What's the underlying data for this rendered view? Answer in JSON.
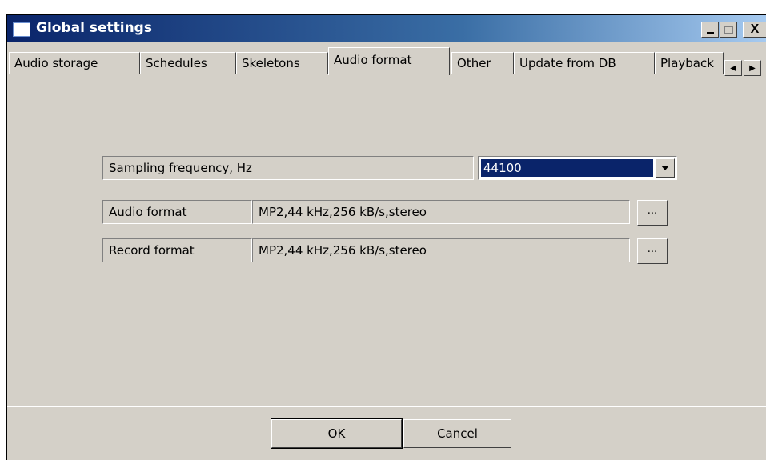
{
  "window": {
    "title": "Global settings",
    "controls": {
      "minimize": "_",
      "maximize": "□",
      "close": "X"
    }
  },
  "tabs": [
    {
      "label": "Audio storage",
      "active": false
    },
    {
      "label": "Schedules",
      "active": false
    },
    {
      "label": "Skeletons",
      "active": false
    },
    {
      "label": "Audio format",
      "active": true
    },
    {
      "label": "Other",
      "active": false
    },
    {
      "label": "Update from DB",
      "active": false
    },
    {
      "label": "Playback",
      "active": false
    }
  ],
  "tab_scroll": {
    "left": "◀",
    "right": "▶"
  },
  "form": {
    "sampling": {
      "label": "Sampling frequency, Hz",
      "value": "44100"
    },
    "audio_format": {
      "label": "Audio format",
      "value": "MP2,44 kHz,256 kB/s,stereo",
      "button": "..."
    },
    "record_format": {
      "label": "Record format",
      "value": "MP2,44 kHz,256 kB/s,stereo",
      "button": "..."
    }
  },
  "buttons": {
    "ok": "OK",
    "cancel": "Cancel"
  },
  "colors": {
    "face": "#d4d0c8",
    "titlebar": "#0a246a",
    "selection": "#0a246a"
  }
}
